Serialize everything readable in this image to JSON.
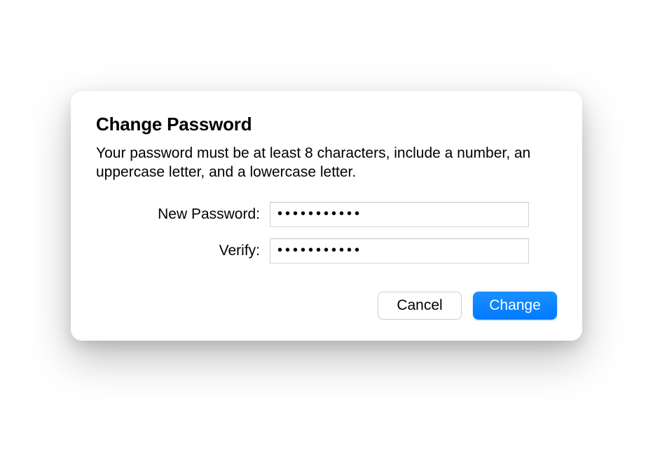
{
  "dialog": {
    "title": "Change Password",
    "description": "Your password must be at least 8 characters, include a number, an uppercase letter, and a lowercase letter.",
    "fields": {
      "new_password": {
        "label": "New Password:",
        "value": "•••••••••••"
      },
      "verify": {
        "label": "Verify:",
        "value": "•••••••••••"
      }
    },
    "buttons": {
      "cancel": "Cancel",
      "change": "Change"
    }
  }
}
